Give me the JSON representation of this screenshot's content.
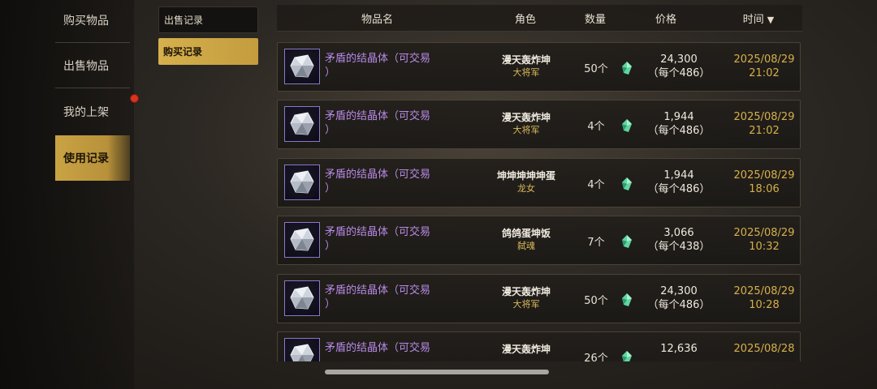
{
  "left_nav": {
    "items": [
      {
        "label": "购买物品"
      },
      {
        "label": "出售物品"
      },
      {
        "label": "我的上架"
      },
      {
        "label": "使用记录"
      }
    ]
  },
  "sub_nav": {
    "items": [
      {
        "label": "出售记录"
      },
      {
        "label": "购买记录"
      }
    ]
  },
  "table": {
    "headers": {
      "name": "物品名",
      "role": "角色",
      "qty": "数量",
      "price": "价格",
      "time": "时间"
    },
    "rows": [
      {
        "name": "矛盾的结晶体（可交易",
        "name_tail": "）",
        "player": "漫天轰炸坤",
        "title": "大将军",
        "qty": "50个",
        "price": "24,300",
        "unit": "（每个486）",
        "date": "2025/08/29",
        "clock": "21:02"
      },
      {
        "name": "矛盾的结晶体（可交易",
        "name_tail": "）",
        "player": "漫天轰炸坤",
        "title": "大将军",
        "qty": "4个",
        "price": "1,944",
        "unit": "（每个486）",
        "date": "2025/08/29",
        "clock": "21:02"
      },
      {
        "name": "矛盾的结晶体（可交易",
        "name_tail": "）",
        "player": "坤坤坤坤坤蛋",
        "title": "龙女",
        "qty": "4个",
        "price": "1,944",
        "unit": "（每个486）",
        "date": "2025/08/29",
        "clock": "18:06"
      },
      {
        "name": "矛盾的结晶体（可交易",
        "name_tail": "）",
        "player": "鸽鸽蛋坤饭",
        "title": "弑魂",
        "qty": "7个",
        "price": "3,066",
        "unit": "（每个438）",
        "date": "2025/08/29",
        "clock": "10:32"
      },
      {
        "name": "矛盾的结晶体（可交易",
        "name_tail": "）",
        "player": "漫天轰炸坤",
        "title": "大将军",
        "qty": "50个",
        "price": "24,300",
        "unit": "（每个486）",
        "date": "2025/08/29",
        "clock": "10:28"
      },
      {
        "name": "矛盾的结晶体（可交易",
        "name_tail": "",
        "player": "漫天轰炸坤",
        "title": "",
        "qty": "26个",
        "price": "12,636",
        "unit": "",
        "date": "2025/08/28",
        "clock": ""
      }
    ]
  },
  "colors": {
    "accent_gold": "#c9a343",
    "item_name_purple": "#b98ae8",
    "time_gold": "#d7b04a",
    "notification_red": "#d8341e",
    "gem_green": "#5fd6a0"
  },
  "icons": {
    "item": "crystal-icon",
    "currency": "gem-icon",
    "sort": "sort-down-icon"
  }
}
